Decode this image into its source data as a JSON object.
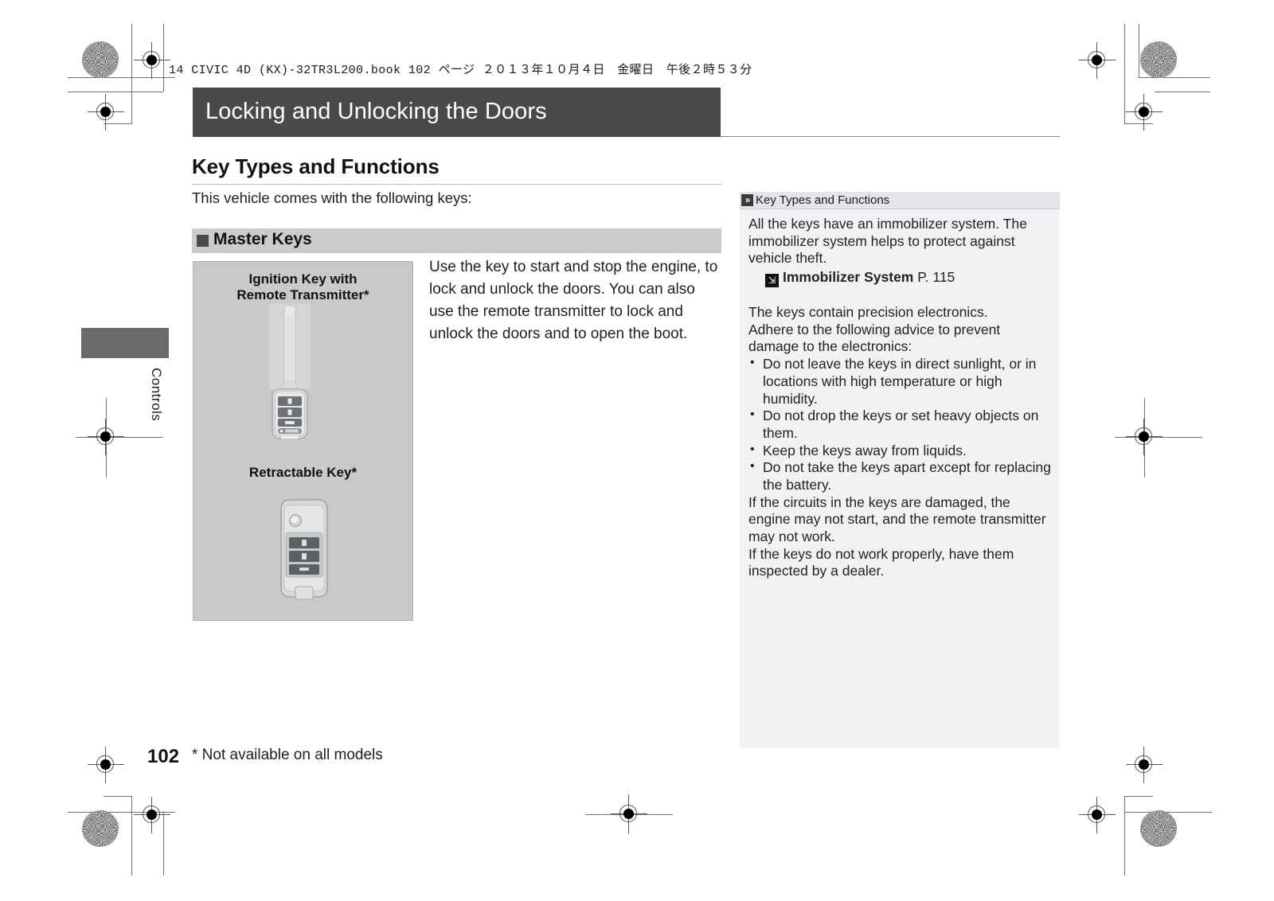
{
  "print_marks": {
    "filestamp": "14 CIVIC 4D (KX)-32TR3L200.book  102 ページ  ２０１３年１０月４日　金曜日　午後２時５３分"
  },
  "chapter": {
    "title": "Locking and Unlocking the Doors"
  },
  "section": {
    "title": "Key Types and Functions",
    "intro": "This vehicle comes with the following keys:"
  },
  "subsection": {
    "title": "Master Keys"
  },
  "figure": {
    "caption_1_line_1": "Ignition Key with",
    "caption_1_line_2": "Remote Transmitter",
    "caption_1_star": "*",
    "caption_2": "Retractable Key",
    "caption_2_star": "*",
    "image_1_name": "ignition-key-with-remote-transmitter",
    "image_2_name": "retractable-key"
  },
  "main_body": {
    "paragraph": "Use the key to start and stop the engine, to lock and unlock the doors. You can also use the remote transmitter to lock and unlock the doors and to open the boot."
  },
  "sidebar": {
    "header_label": "Key Types and Functions",
    "header_icon": "double-chevron-right-icon",
    "paragraph_1": "All the keys have an immobilizer system. The immobilizer system helps to protect against vehicle theft.",
    "xref": {
      "icon": "arrow-reference-icon",
      "title": "Immobilizer System",
      "page": "P. 115"
    },
    "paragraph_2_line_1": "The keys contain precision electronics.",
    "paragraph_2_line_2": "Adhere to the following advice to prevent damage to the electronics:",
    "bullets": [
      "Do not leave the keys in direct sunlight, or in locations with high temperature or high humidity.",
      "Do not drop the keys or set heavy objects on them.",
      "Keep the keys away from liquids.",
      "Do not take the keys apart except for replacing the battery."
    ],
    "paragraph_3": "If the circuits in the keys are damaged, the engine may not start, and the remote transmitter may not work.",
    "paragraph_4": "If the keys do not work properly, have them inspected by a dealer."
  },
  "thumb_tab": {
    "label": "Controls"
  },
  "footer": {
    "page_number": "102",
    "footnote": "* Not available on all models"
  },
  "colors": {
    "chapter_bar": "#4a4a4a",
    "subhead_band": "#cccccc",
    "figure_bg": "#c9c9c9",
    "sidebar_bg": "#f1f2f4",
    "sidebar_head_bg": "#e3e5e8",
    "thumb_tab": "#6a6a6a"
  }
}
